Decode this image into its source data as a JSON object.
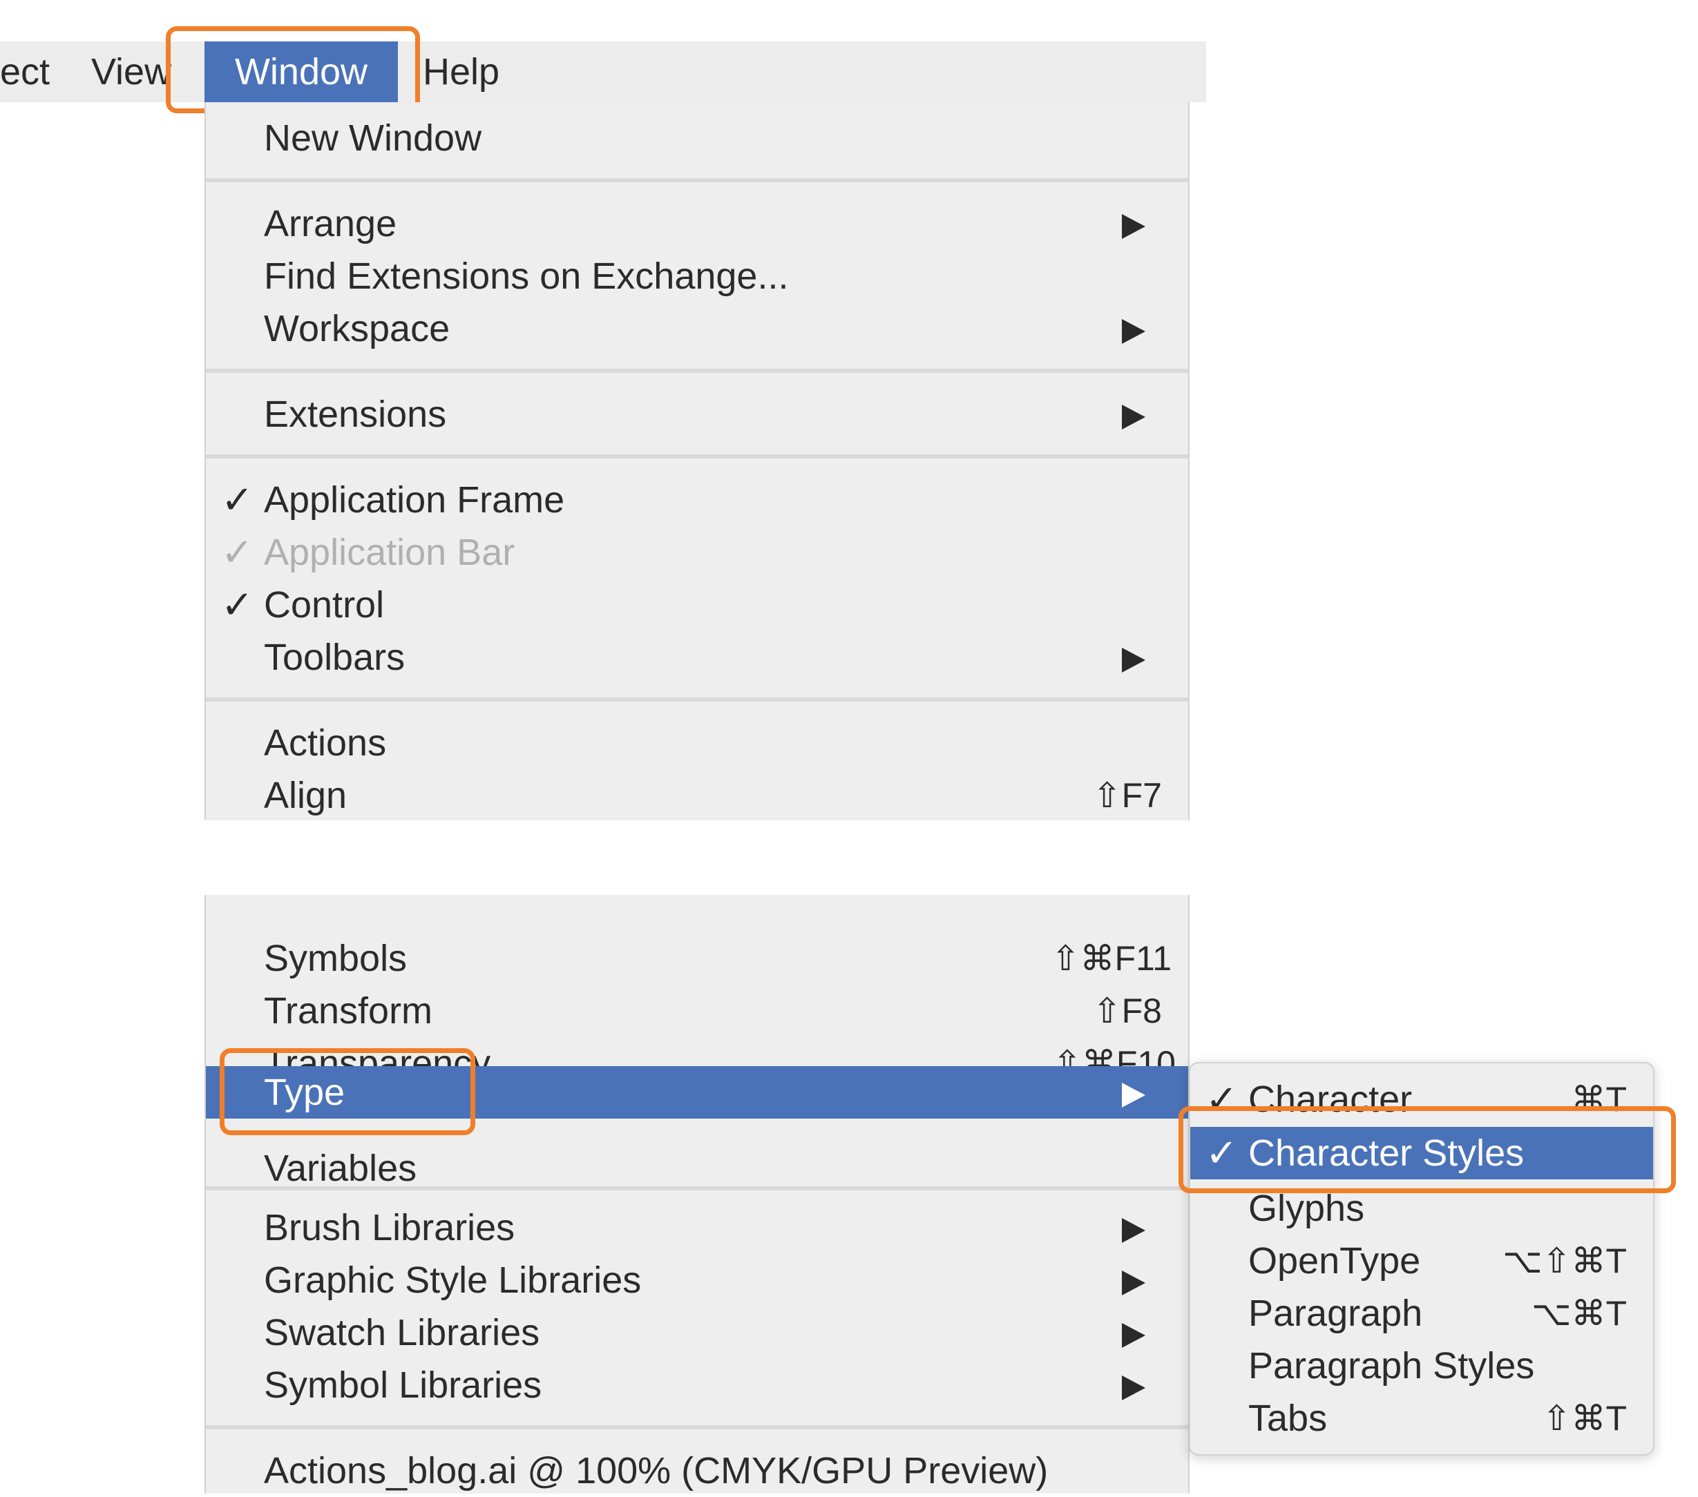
{
  "menubar": {
    "items": [
      {
        "label": "ect"
      },
      {
        "label": "View"
      },
      {
        "label": "Window"
      },
      {
        "label": "Help"
      }
    ]
  },
  "window_menu_top": {
    "items": [
      {
        "label": "New Window"
      },
      {
        "label": "Arrange"
      },
      {
        "label": "Find Extensions on Exchange..."
      },
      {
        "label": "Workspace"
      },
      {
        "label": "Extensions"
      },
      {
        "label": "Application Frame",
        "check": "✓"
      },
      {
        "label": "Application Bar",
        "check": "✓"
      },
      {
        "label": "Control",
        "check": "✓"
      },
      {
        "label": "Toolbars"
      },
      {
        "label": "Actions"
      },
      {
        "label": "Align",
        "shortcut": "⇧F7"
      }
    ]
  },
  "window_menu_bottom": {
    "items": [
      {
        "label": "Symbols",
        "shortcut": "⇧⌘F11"
      },
      {
        "label": "Transform",
        "shortcut": "⇧F8"
      },
      {
        "label": "Transparency",
        "shortcut": "⇧⌘F10"
      },
      {
        "label": "Type"
      },
      {
        "label": "Variables"
      },
      {
        "label": "Brush Libraries"
      },
      {
        "label": "Graphic Style Libraries"
      },
      {
        "label": "Swatch Libraries"
      },
      {
        "label": "Symbol Libraries"
      },
      {
        "label": "Actions_blog.ai @ 100% (CMYK/GPU Preview)"
      }
    ]
  },
  "type_submenu": {
    "items": [
      {
        "label": "Character",
        "check": "✓",
        "shortcut": "⌘T"
      },
      {
        "label": "Character Styles",
        "check": "✓"
      },
      {
        "label": "Glyphs"
      },
      {
        "label": "OpenType",
        "shortcut": "⌥⇧⌘T"
      },
      {
        "label": "Paragraph",
        "shortcut": "⌥⌘T"
      },
      {
        "label": "Paragraph Styles"
      },
      {
        "label": "Tabs",
        "shortcut": "⇧⌘T"
      }
    ]
  },
  "colors": {
    "selection": "#4a72b8",
    "highlight_outline": "#f07f2a",
    "menu_bg": "#eeeeee"
  }
}
